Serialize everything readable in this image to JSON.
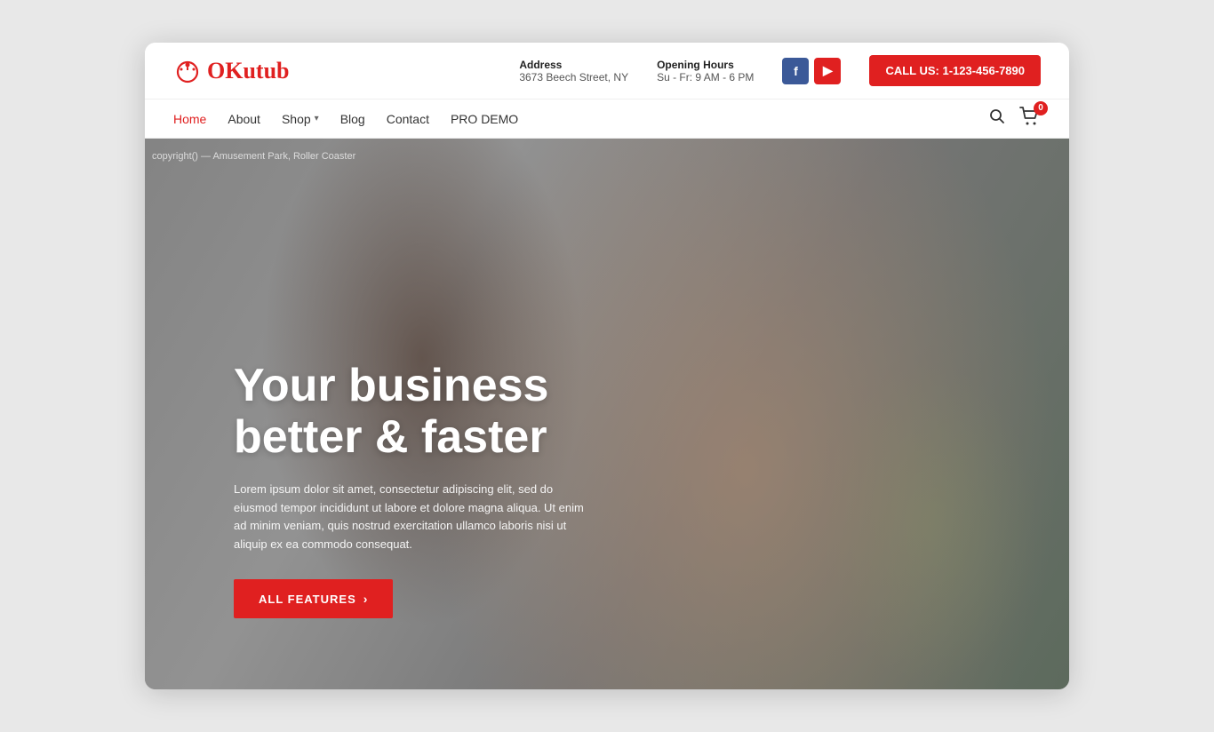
{
  "logo": {
    "icon_letter": "O",
    "text_prefix": "",
    "text_main": "Kutub",
    "text_highlight": "O"
  },
  "header": {
    "address_label": "Address",
    "address_value": "3673 Beech Street, NY",
    "hours_label": "Opening Hours",
    "hours_value": "Su - Fr: 9 AM - 6 PM",
    "call_button": "CALL US: 1-123-456-7890",
    "facebook_label": "f",
    "youtube_label": "▶"
  },
  "nav": {
    "links": [
      {
        "label": "Home",
        "active": true
      },
      {
        "label": "About",
        "active": false
      },
      {
        "label": "Shop",
        "active": false,
        "has_dropdown": true
      },
      {
        "label": "Blog",
        "active": false
      },
      {
        "label": "Contact",
        "active": false
      },
      {
        "label": "PRO DEMO",
        "active": false
      }
    ],
    "cart_count": "0"
  },
  "hero": {
    "copyright_text": "copyright() — Amusement Park, Roller Coaster",
    "title_line1": "Your business",
    "title_line2": "better & faster",
    "description": "Lorem ipsum dolor sit amet, consectetur adipiscing elit, sed do eiusmod tempor incididunt ut labore et dolore magna aliqua. Ut enim ad minim veniam, quis nostrud exercitation ullamco laboris nisi ut aliquip ex ea commodo consequat.",
    "cta_button": "ALL FEATURES",
    "cta_arrow": "›"
  }
}
